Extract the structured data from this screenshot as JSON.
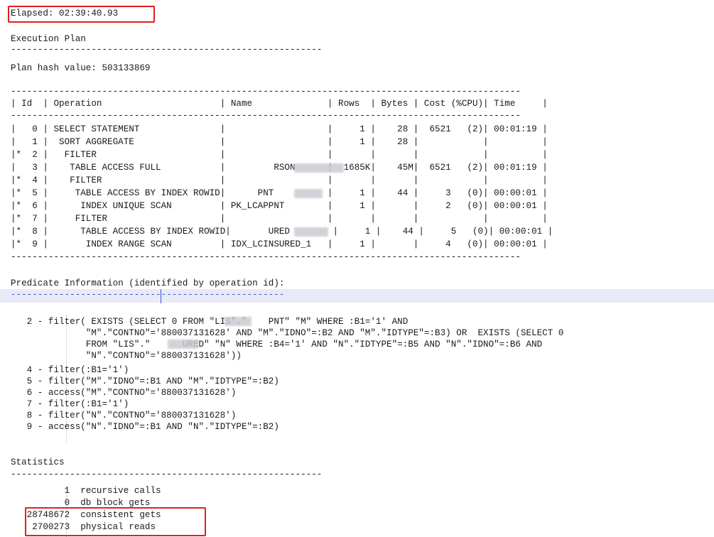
{
  "elapsed": "Elapsed: 02:39:40.93",
  "plan": {
    "heading": "Execution Plan",
    "rule_short": "----------------------------------------------------------",
    "hash": "Plan hash value: 503133869",
    "rule_long": "-----------------------------------------------------------------------------------------------",
    "header": "| Id  | Operation                      | Name              | Rows  | Bytes | Cost (%CPU)| Time     |",
    "rows": [
      "|   0 | SELECT STATEMENT               |                   |     1 |    28 |  6521   (2)| 00:01:19 |",
      "|   1 |  SORT AGGREGATE                |                   |     1 |    28 |            |          |",
      "|*  2 |   FILTER                       |                   |       |       |            |          |",
      "|   3 |    TABLE ACCESS FULL           |         RSON      |  1685K|    45M|  6521   (2)| 00:01:19 |",
      "|*  4 |    FILTER                      |                   |       |       |            |          |",
      "|*  5 |     TABLE ACCESS BY INDEX ROWID|      PNT          |     1 |    44 |     3   (0)| 00:00:01 |",
      "|*  6 |      INDEX UNIQUE SCAN         | PK_LCAPPNT        |     1 |       |     2   (0)| 00:00:01 |",
      "|*  7 |     FILTER                     |                   |       |       |            |          |",
      "|*  8 |      TABLE ACCESS BY INDEX ROWID|       URED        |     1 |    44 |     5   (0)| 00:00:01 |",
      "|*  9 |       INDEX RANGE SCAN         | IDX_LCINSURED_1   |     1 |       |     4   (0)| 00:00:01 |"
    ]
  },
  "predicate": {
    "heading": "Predicate Information (identified by operation id):",
    "rule": "---------------------------------------------------",
    "lines": [
      "   2 - filter( EXISTS (SELECT 0 FROM \"LIS\".\"    PNT\" \"M\" WHERE :B1='1' AND",
      "              \"M\".\"CONTNO\"='880037131628' AND \"M\".\"IDNO\"=:B2 AND \"M\".\"IDTYPE\"=:B3) OR  EXISTS (SELECT 0",
      "              FROM \"LIS\".\"      URED\" \"N\" WHERE :B4='1' AND \"N\".\"IDTYPE\"=:B5 AND \"N\".\"IDNO\"=:B6 AND",
      "              \"N\".\"CONTNO\"='880037131628'))",
      "   4 - filter(:B1='1')",
      "   5 - filter(\"M\".\"IDNO\"=:B1 AND \"M\".\"IDTYPE\"=:B2)",
      "   6 - access(\"M\".\"CONTNO\"='880037131628')",
      "   7 - filter(:B1='1')",
      "   8 - filter(\"N\".\"CONTNO\"='880037131628')",
      "   9 - access(\"N\".\"IDNO\"=:B1 AND \"N\".\"IDTYPE\"=:B2)"
    ]
  },
  "statistics": {
    "heading": "Statistics",
    "rule": "----------------------------------------------------------",
    "lines": [
      "          1  recursive calls",
      "          0  db block gets",
      "   28748672  consistent gets",
      "    2700273  physical reads"
    ]
  }
}
